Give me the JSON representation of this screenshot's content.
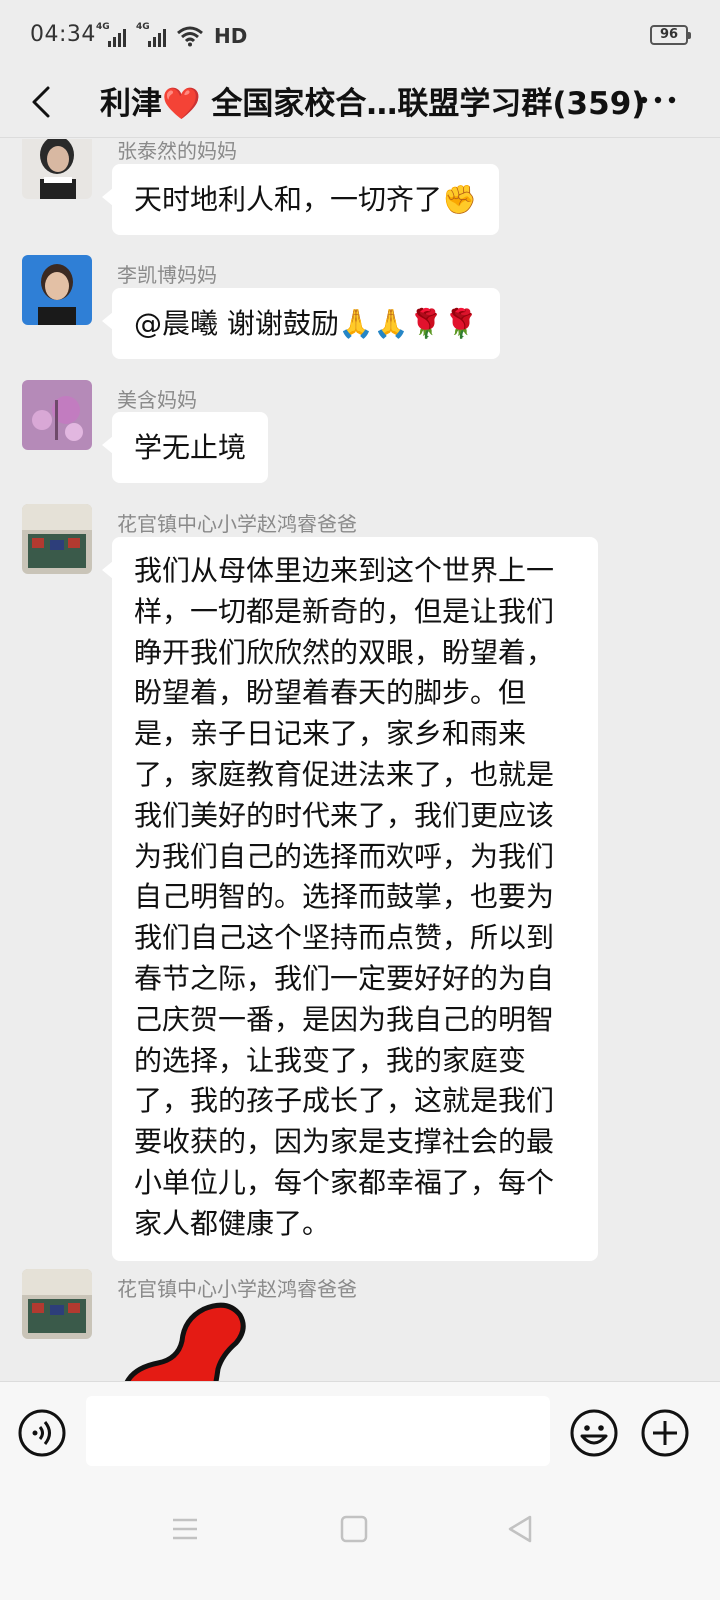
{
  "status_bar": {
    "time": "04:34",
    "network_1": "4G",
    "network_2": "4G",
    "hd": "HD",
    "battery": "96"
  },
  "nav": {
    "title": "利津❤️ 全国家校合…联盟学习群(359)"
  },
  "messages": [
    {
      "sender": "张泰然的妈妈",
      "text": "天时地利人和，一切齐了✊"
    },
    {
      "sender": "李凯博妈妈",
      "text": "@晨曦  谢谢鼓励🙏🙏🌹🌹"
    },
    {
      "sender": "美含妈妈",
      "text": "学无止境"
    },
    {
      "sender": "花官镇中心小学赵鸿睿爸爸",
      "text": "我们从母体里边来到这个世界上一\n样，一切都是新奇的，但是让我们\n睁开我们欣欣然的双眼，盼望着，\n盼望着，盼望着春天的脚步。但\n是，亲子日记来了，家乡和雨来\n了，家庭教育促进法来了，也就是\n我们美好的时代来了，我们更应该\n为我们自己的选择而欢呼，为我们\n自己明智的。选择而鼓掌，也要为\n我们自己这个坚持而点赞，所以到\n春节之际，我们一定要好好的为自\n己庆贺一番，是因为我自己的明智\n的选择，让我变了，我的家庭变\n了，我的孩子成长了，这就是我们\n要收获的，因为家是支撑社会的最\n小单位儿，每个家都幸福了，每个\n家人都健康了。"
    },
    {
      "sender": "花官镇中心小学赵鸿睿爸爸",
      "text": ""
    }
  ],
  "input": {
    "value": ""
  },
  "icons": [
    "back-icon",
    "more-icon",
    "voice-icon",
    "emoji-icon",
    "plus-icon",
    "menu-icon",
    "home-icon",
    "back-triangle-icon"
  ]
}
